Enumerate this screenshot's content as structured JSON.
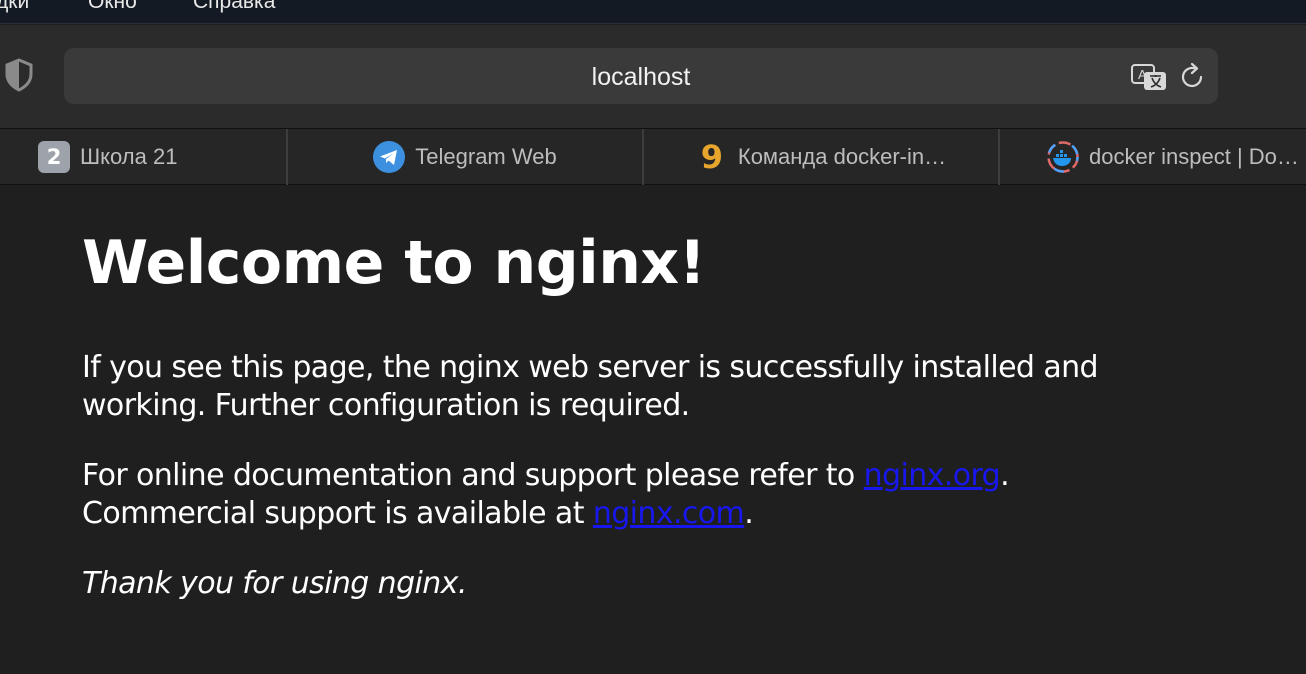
{
  "menubar": {
    "items": [
      "дки",
      "Окно",
      "Справка"
    ]
  },
  "toolbar": {
    "address": "localhost",
    "icons": [
      "shield-icon",
      "translate-icon",
      "reload-icon"
    ]
  },
  "tabs": [
    {
      "title": "Школа 21",
      "favicon_text": "2",
      "icon": "school21-favicon"
    },
    {
      "title": "Telegram Web",
      "icon": "telegram-favicon"
    },
    {
      "title": "Команда docker-in…",
      "favicon_text": "9",
      "icon": "nine-favicon"
    },
    {
      "title": "docker inspect | Do…",
      "icon": "docker-favicon"
    }
  ],
  "page": {
    "heading": "Welcome to nginx!",
    "p1_line1": "If you see this page, the nginx web server is successfully installed and",
    "p1_line2": "working. Further configuration is required.",
    "p2_line1_pre": "For online documentation and support please refer to ",
    "p2_link1": "nginx.org",
    "p2_line1_post": ".",
    "p2_line2_pre": "Commercial support is available at ",
    "p2_link2": "nginx.com",
    "p2_line2_post": ".",
    "p3": "Thank you for using nginx."
  },
  "colors": {
    "background": "#1f1f1f",
    "link": "#1717ee",
    "toolbar": "#2b2b2b",
    "address_bar": "#3a3a3a"
  }
}
